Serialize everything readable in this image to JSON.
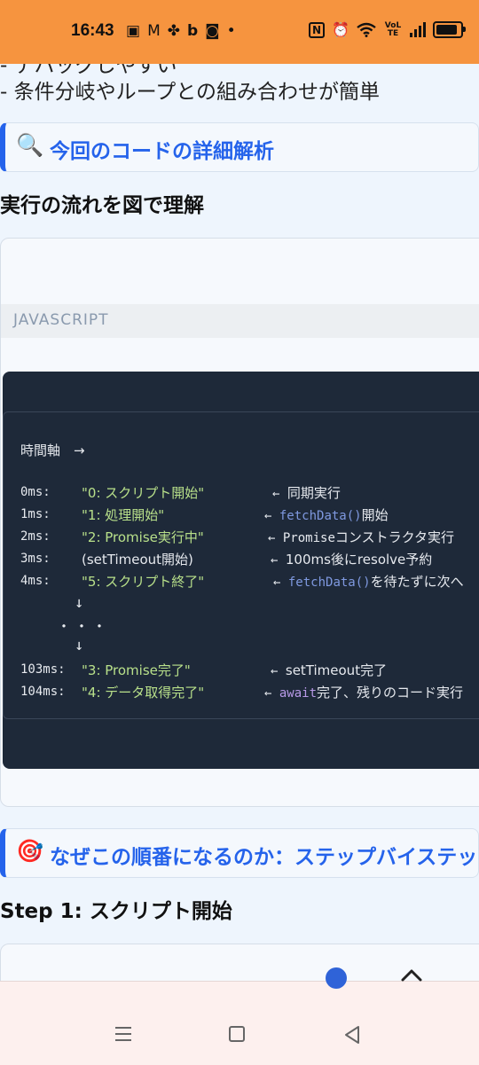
{
  "status": {
    "time": "16:43",
    "network": "VoLTE",
    "left_icons": [
      "sim-icon",
      "gmail-icon",
      "pinwheel-icon",
      "b-app-icon",
      "instagram-icon",
      "dot-icon"
    ],
    "right_icons": [
      "nfc-icon",
      "alarm-icon",
      "wifi-icon",
      "volte-icon",
      "signal-icon",
      "battery-icon"
    ]
  },
  "content": {
    "partial_bullet": "- デバッグしやすい",
    "bullet_line": "- 条件分岐やループとの組み合わせが簡単",
    "section1": {
      "icon": "🔍",
      "icon_name": "magnifier-icon",
      "title": "今回のコードの詳細解析"
    },
    "subtitle1": "実行の流れを図で理解",
    "code_card": {
      "language": "JAVASCRIPT",
      "header": "時間軸　→",
      "timeline": [
        {
          "time": "0ms:",
          "label": "\"0: スクリプト開始\"",
          "arrow": "←",
          "note_pre": "",
          "note_code": "",
          "note_post": "同期実行"
        },
        {
          "time": "1ms:",
          "label": "\"1: 処理開始\"",
          "arrow": "←",
          "note_pre": "",
          "note_code": "fetchData()",
          "note_post": "開始"
        },
        {
          "time": "2ms:",
          "label": "\"2: Promise実行中\"",
          "arrow": "←",
          "note_pre": "Promise",
          "note_code": "",
          "note_post": "コンストラクタ実行"
        },
        {
          "time": "3ms:",
          "label": "(setTimeout開始)",
          "arrow": "←",
          "note_pre": "100ms後にresolve予約",
          "note_code": "",
          "note_post": ""
        },
        {
          "time": "4ms:",
          "label": "\"5: スクリプト終了\"",
          "arrow": "←",
          "note_pre": "",
          "note_code": "fetchData()",
          "note_post": "を待たずに次へ"
        },
        {
          "time": "103ms:",
          "label": "\"3: Promise完了\"",
          "arrow": "←",
          "note_pre": "setTimeout完了",
          "note_code": "",
          "note_post": ""
        },
        {
          "time": "104ms:",
          "label": "\"4: データ取得完了\"",
          "arrow": "←",
          "note_pre": "",
          "note_code": "await",
          "note_post": "完了、残りのコード実行"
        }
      ],
      "down_arrow": "↓",
      "ellipsis": "・・・"
    },
    "section2": {
      "icon": "🎯",
      "icon_name": "target-icon",
      "title": "なぜこの順番になるのか：ステップバイステップ"
    },
    "subtitle2": "Step 1: スクリプト開始"
  },
  "colors": {
    "status_bar": "#f6943f",
    "accent": "#2563eb",
    "code_bg": "#1e2939",
    "string_green": "#b8e08a",
    "code_blue": "#7f99e0",
    "keyword_purple": "#b89ae8"
  }
}
